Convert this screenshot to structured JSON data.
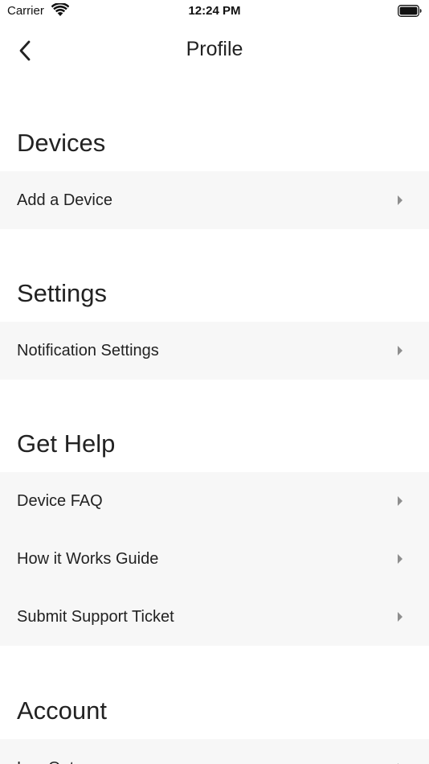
{
  "status_bar": {
    "carrier": "Carrier",
    "time": "12:24 PM"
  },
  "nav": {
    "title": "Profile",
    "back_icon": "chevron-left-icon"
  },
  "sections": [
    {
      "title": "Devices",
      "items": [
        {
          "label": "Add a Device"
        }
      ]
    },
    {
      "title": "Settings",
      "items": [
        {
          "label": "Notification Settings"
        }
      ]
    },
    {
      "title": "Get Help",
      "items": [
        {
          "label": "Device FAQ"
        },
        {
          "label": "How it Works Guide"
        },
        {
          "label": "Submit Support Ticket"
        }
      ]
    },
    {
      "title": "Account",
      "items": [
        {
          "label": "Log Out"
        }
      ]
    }
  ],
  "colors": {
    "row_background": "#f7f7f7",
    "text": "#222222",
    "chevron": "#8e8e8e"
  }
}
